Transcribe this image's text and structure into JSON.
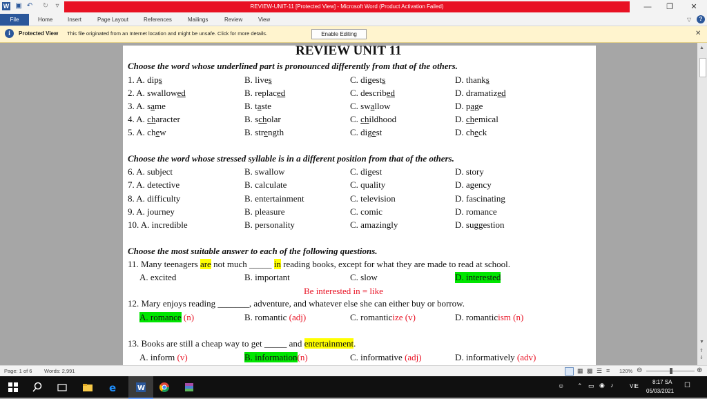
{
  "window": {
    "title": "REVIEW-UNIT-11 [Protected View] - Microsoft Word (Product Activation Failed)"
  },
  "ribbon": {
    "file": "File",
    "tabs": [
      "Home",
      "Insert",
      "Page Layout",
      "References",
      "Mailings",
      "Review",
      "View"
    ]
  },
  "protected_view": {
    "label": "Protected View",
    "message": "This file originated from an Internet location and might be unsafe. Click for more details.",
    "button": "Enable Editing"
  },
  "document": {
    "title": "REVIEW UNIT 11",
    "s1_head": "Choose the word whose underlined part is pronounced differently from that of the others.",
    "s1": [
      [
        "1. A. dip",
        "s",
        "",
        "B. live",
        "s",
        "",
        "C. digest",
        "s",
        "",
        "D. thank",
        "s",
        ""
      ],
      [
        "2. A. swallow",
        "ed",
        "",
        "B. replac",
        "ed",
        "",
        "C. describ",
        "ed",
        "",
        "D. dramatiz",
        "ed",
        ""
      ],
      [
        "3. A. s",
        "a",
        "me",
        "B. t",
        "a",
        "ste",
        "C. sw",
        "a",
        "llow",
        "D. p",
        "a",
        "ge"
      ],
      [
        "4. A. ",
        "ch",
        "aracter",
        "B. s",
        "ch",
        "olar",
        "C. ",
        "ch",
        "ildhood",
        "D. ",
        "ch",
        "emical"
      ],
      [
        "5. A. ch",
        "e",
        "w",
        "B. str",
        "e",
        "ngth",
        "C. dig",
        "e",
        "st",
        "D. ch",
        "e",
        "ck"
      ]
    ],
    "s2_head": "Choose the word whose stressed syllable is in a different position from that of the others.",
    "s2": [
      [
        "6. A. subject",
        "B. swallow",
        "C. digest",
        "D. story"
      ],
      [
        "7. A. detective",
        "B. calculate",
        "C. quality",
        "D. agency"
      ],
      [
        "8. A. difficulty",
        "B. entertainment",
        "C. television",
        "D. fascinating"
      ],
      [
        "9. A. journey",
        "B. pleasure",
        "C. comic",
        "D. romance"
      ],
      [
        "10. A. incredible",
        "B. personality",
        "C. amazingly",
        "D. suggestion"
      ]
    ],
    "s3_head": "Choose the most suitable answer to each of the following questions.",
    "q11": {
      "pre": "11. Many teenagers ",
      "are": "are",
      "mid": " not much _____ ",
      "in": "in",
      "post": " reading books, except for what they are made to read at school.",
      "a": "A. excited",
      "b": "B. important",
      "c": "C. slow",
      "d": "D. interested",
      "note": "Be interested  in  = like"
    },
    "q12": {
      "text": "12. Mary enjoys reading _______, adventure, and whatever else she can either buy or borrow.",
      "a": "A. romance",
      "a_pos": " (n)",
      "b": "B. romantic",
      "b_pos": " (adj)",
      "c_base": "C. romantic",
      "c_suf": "ize",
      "c_pos": " (v)",
      "d_base": "D. romantic",
      "d_suf": "ism",
      "d_pos": " (n)"
    },
    "q13": {
      "pre": "13. Books are still a cheap way to get _____ and ",
      "ent": "entertainment",
      "post": ".",
      "a": "A. inform",
      "a_pos": " (v)",
      "b": "B. information",
      "b_pos": "(n)",
      "c": "C. informative",
      "c_pos": " (adj)",
      "d": "D. informatively",
      "d_pos": " (adv)"
    }
  },
  "status": {
    "page": "Page: 1 of 6",
    "words": "Words: 2,991",
    "zoom": "120%"
  },
  "taskbar": {
    "lang": "VIE",
    "time": "8:17 SA",
    "date": "05/03/2021"
  }
}
